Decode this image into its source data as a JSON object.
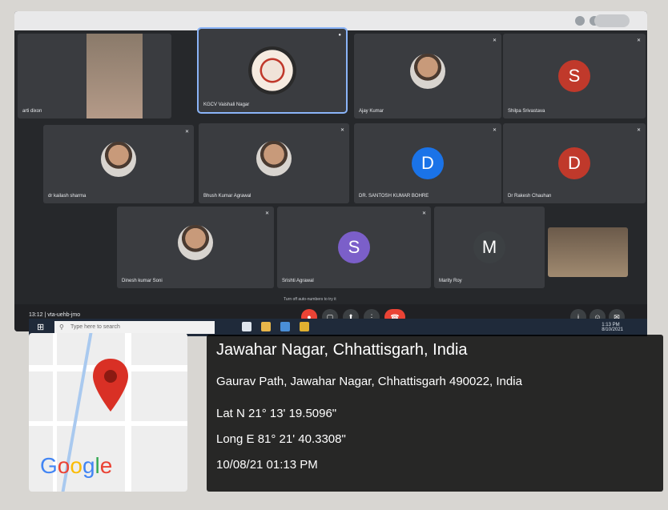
{
  "meet": {
    "time": "13:12",
    "meeting_code": "vta-uehb-jmo",
    "notice": "Turn off auto-numbers to try it",
    "participants": [
      {
        "name": "arti dixon",
        "type": "photo"
      },
      {
        "name": "KGCV Vaishali Nagar",
        "type": "emblem",
        "active": true
      },
      {
        "name": "Ajay Kumar",
        "type": "face"
      },
      {
        "name": "Shilpa Srivastava",
        "type": "initial",
        "initial": "S",
        "color": "#c0392b"
      },
      {
        "name": "dr kailash sharma",
        "type": "face"
      },
      {
        "name": "Bhush Kumar Agrawal",
        "type": "face"
      },
      {
        "name": "DR. SANTOSH KUMAR BOHRE",
        "type": "initial",
        "initial": "D",
        "color": "#1a73e8"
      },
      {
        "name": "Dr Rakesh Chauhan",
        "type": "initial",
        "initial": "D",
        "color": "#c0392b"
      },
      {
        "name": "Dinesh kumar Soni",
        "type": "face"
      },
      {
        "name": "Srishti Agrawal",
        "type": "initial",
        "initial": "S",
        "color": "#7b5fc9"
      },
      {
        "name": "Marity Roy",
        "type": "initial",
        "initial": "M",
        "color": "#3c4043"
      },
      {
        "name": "",
        "type": "photo"
      }
    ]
  },
  "taskbar": {
    "search_placeholder": "Type here to search",
    "tray_time": "1:13 PM",
    "tray_date": "8/10/2021"
  },
  "location": {
    "title": "Jawahar Nagar, Chhattisgarh, India",
    "address": "Gaurav Path, Jawahar Nagar, Chhattisgarh 490022, India",
    "lat": "Lat N 21° 13' 19.5096\"",
    "long": "Long E 81° 21' 40.3308\"",
    "datetime": "10/08/21 01:13 PM"
  },
  "map": {
    "logo_text": "Google",
    "pin_color": "#d93025",
    "logo_colors": [
      "#4285f4",
      "#ea4335",
      "#fbbc05",
      "#4285f4",
      "#34a853",
      "#ea4335"
    ]
  },
  "icons": [
    "map-pin-icon",
    "mic-icon",
    "camera-icon",
    "present-icon",
    "more-icon",
    "end-call-icon",
    "search-icon",
    "windows-icon",
    "info-icon",
    "people-icon",
    "chat-icon"
  ]
}
